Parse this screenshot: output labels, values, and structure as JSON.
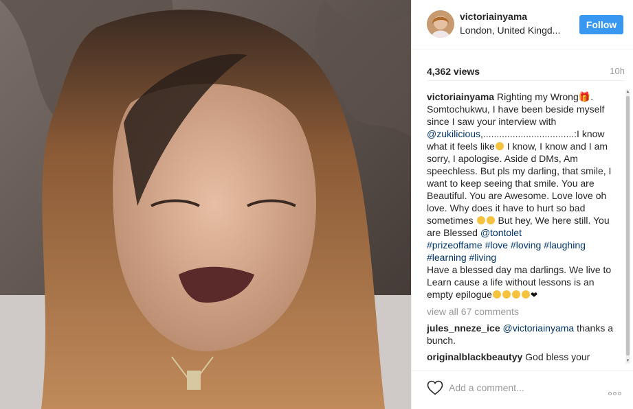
{
  "post": {
    "username": "victoriainyama",
    "location": "London, United Kingd...",
    "follow_label": "Follow",
    "views": "4,362 views",
    "time": "10h"
  },
  "caption": {
    "username": "victoriainyama",
    "part1": " Righting my Wrong",
    "part2": ". Somtochukwu, I have been beside myself since I saw your interview with ",
    "mention1": "@zukilicious",
    "part3": ",..................................:I know what it feels like",
    "part4": " I know, I know and I am sorry, I apologise. Aside d DMs, Am speechless. But pls my darling, that smile, I want to keep seeing that smile. You are Beautiful. You are Awesome. Love love oh love. Why does it have to hurt so bad sometimes ",
    "part5": " But hey, We here still. You are Blessed ",
    "mention2": "@tontolet",
    "hashtags": "#prizeoffame #love #loving #laughing #learning #living",
    "part6": "Have a blessed day ma darlings. We live to Learn cause a life without lessons is an empty epilogue"
  },
  "view_all": "view all 67 comments",
  "comments": [
    {
      "username": "jules_nneze_ice",
      "mention": "@victoriainyama",
      "text": " thanks a bunch."
    },
    {
      "username": "originalblackbeautyy",
      "text": " God bless your"
    }
  ],
  "comment_box": {
    "placeholder": "Add a comment..."
  },
  "icons": {
    "heart": "heart-outline-icon",
    "more": "more-options-icon"
  },
  "colors": {
    "follow_bg": "#3897f0",
    "link": "#003569",
    "muted": "#999999"
  }
}
